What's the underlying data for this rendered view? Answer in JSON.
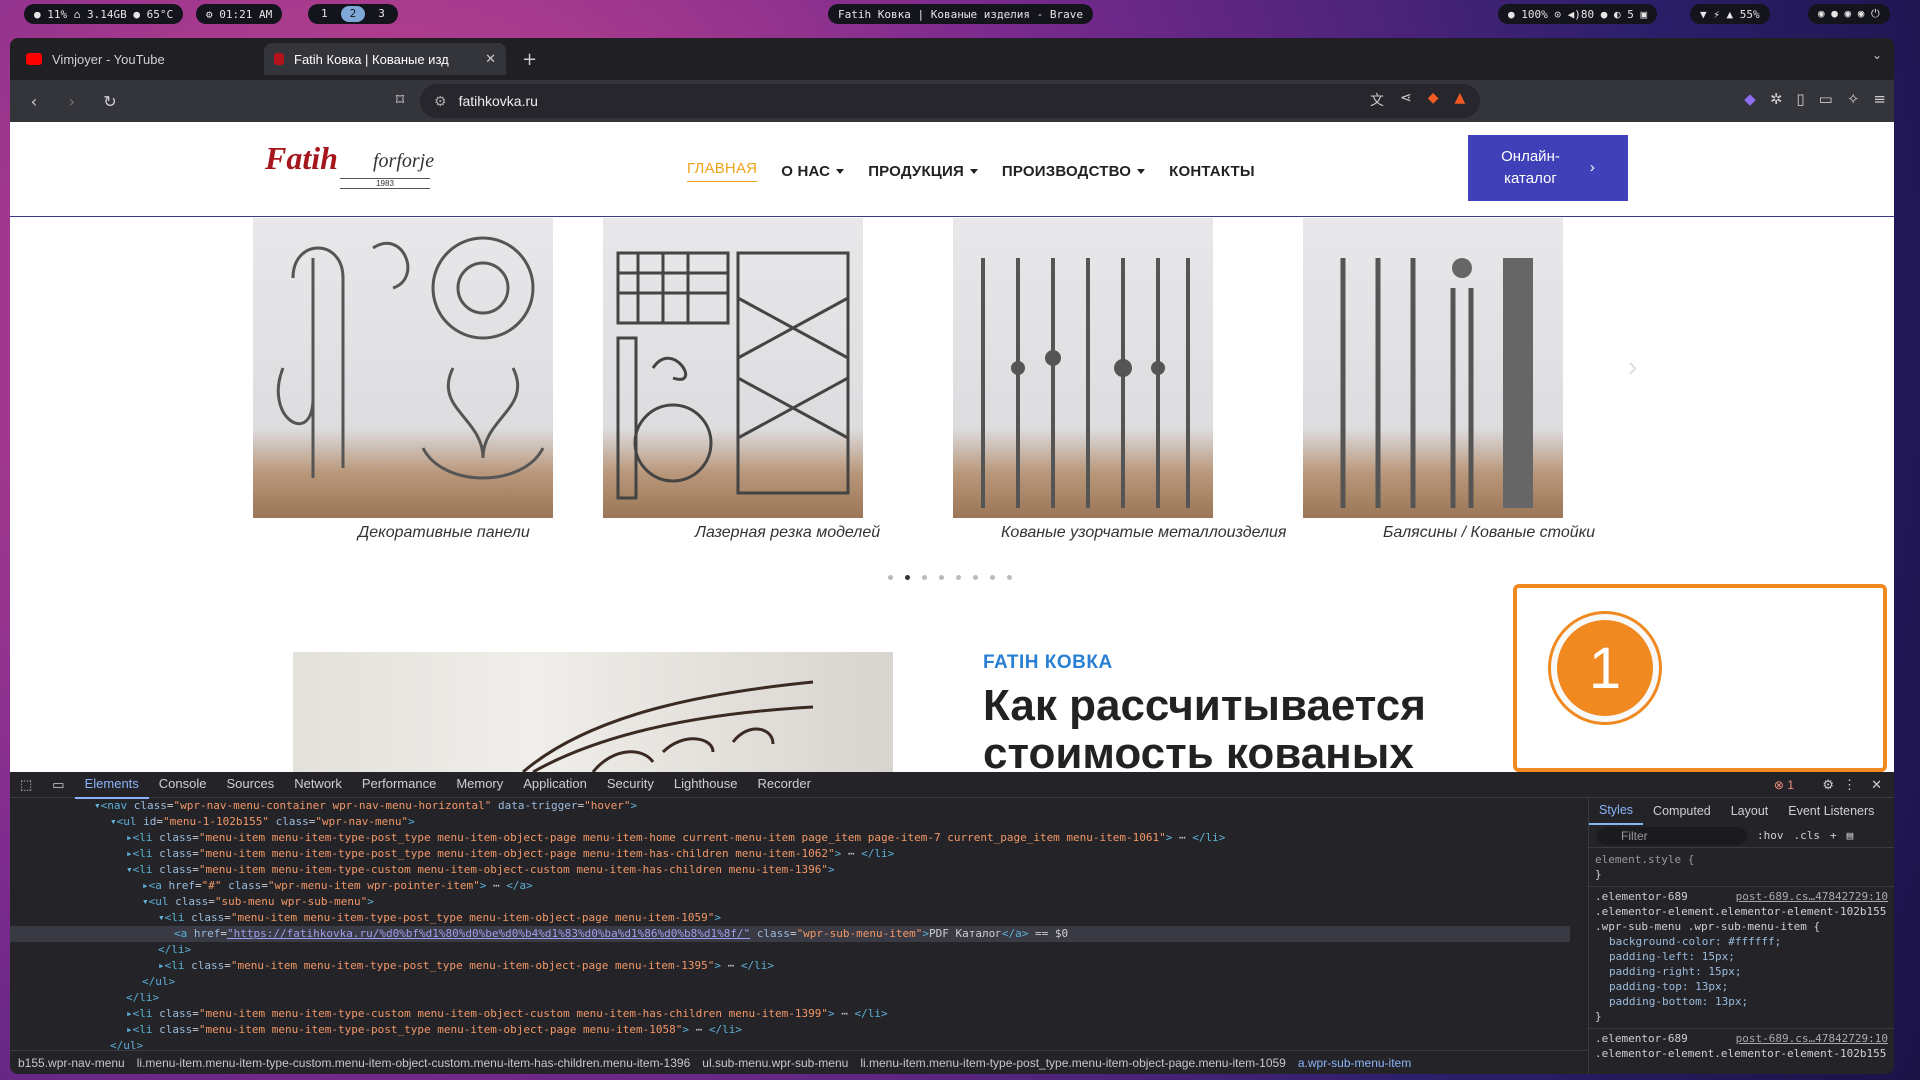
{
  "waybar": {
    "left": "● 11%  ⌂ 3.14GB  ● 65°C",
    "clock": "⚙ 01:21 AM",
    "workspaces": [
      "1",
      "2",
      "3"
    ],
    "active_workspace_index": 1,
    "title": "Fatih Ковка | Кованые изделия - Brave",
    "status": "● 100%  ⊙  ◀)80  ● ◐ 5  ▣",
    "net": "▼ ⚡ ▲ 55%",
    "tray": "◉ ● ◉ ◉ ⏻"
  },
  "browser": {
    "tabs": [
      {
        "title": "Vimjoyer - YouTube",
        "favicon_color": "#ff0000",
        "active": false
      },
      {
        "title": "Fatih Ковка | Кованые изд",
        "favicon_color": "#b3121b",
        "active": true
      }
    ],
    "new_tab": "+",
    "url": "fatihkovka.ru",
    "brave_badge": "1"
  },
  "site": {
    "logo": {
      "main": "Fatih",
      "script": "forforje",
      "year": "1983"
    },
    "nav": [
      {
        "label": "ГЛАВНАЯ",
        "active": true,
        "has_menu": false
      },
      {
        "label": "О НАС",
        "active": false,
        "has_menu": true
      },
      {
        "label": "ПРОДУКЦИЯ",
        "active": false,
        "has_menu": true
      },
      {
        "label": "ПРОИЗВОДСТВО",
        "active": false,
        "has_menu": true
      },
      {
        "label": "КОНТАКТЫ",
        "active": false,
        "has_menu": false
      }
    ],
    "catalog_button": "Онлайн-\nкаталог",
    "slides": [
      {
        "caption": "Декоративные панели"
      },
      {
        "caption": "Лазерная резка моделей"
      },
      {
        "caption": "Кованые узорчатые металлоизделия"
      },
      {
        "caption": "Балясины / Кованые стойки"
      }
    ],
    "dots_count": 8,
    "active_dot": 1,
    "brand": "FATIH КОВКА",
    "heading": "Как рассчитывается стоимость кованых",
    "notification_count": "1"
  },
  "devtools": {
    "tabs": [
      "Elements",
      "Console",
      "Sources",
      "Network",
      "Performance",
      "Memory",
      "Application",
      "Security",
      "Lighthouse",
      "Recorder"
    ],
    "active_tab": "Elements",
    "error_count": "1",
    "dom_lines": [
      {
        "indent": 10,
        "html": "<span class='tg'>▾&lt;nav</span> <span class='an'>class</span>=<span class='av'>\"wpr-nav-menu-container wpr-nav-menu-horizontal\"</span> <span class='an'>data-trigger</span>=<span class='av'>\"hover\"</span><span class='tg'>&gt;</span>"
      },
      {
        "indent": 12,
        "html": "<span class='tg'>▾&lt;ul</span> <span class='an'>id</span>=<span class='av'>\"menu-1-102b155\"</span> <span class='an'>class</span>=<span class='av'>\"wpr-nav-menu\"</span><span class='tg'>&gt;</span>"
      },
      {
        "indent": 14,
        "html": "<span class='tg'>▸&lt;li</span> <span class='an'>class</span>=<span class='av'>\"menu-item menu-item-type-post_type menu-item-object-page menu-item-home current-menu-item page_item page-item-7 current_page_item menu-item-1061\"</span><span class='tg'>&gt;</span> ⋯ <span class='tg'>&lt;/li&gt;</span>"
      },
      {
        "indent": 14,
        "html": "<span class='tg'>▸&lt;li</span> <span class='an'>class</span>=<span class='av'>\"menu-item menu-item-type-post_type menu-item-object-page menu-item-has-children menu-item-1062\"</span><span class='tg'>&gt;</span> ⋯ <span class='tg'>&lt;/li&gt;</span>"
      },
      {
        "indent": 14,
        "html": "<span class='tg'>▾&lt;li</span> <span class='an'>class</span>=<span class='av'>\"menu-item menu-item-type-custom menu-item-object-custom menu-item-has-children menu-item-1396\"</span><span class='tg'>&gt;</span>"
      },
      {
        "indent": 16,
        "html": "<span class='tg'>▸&lt;a</span> <span class='an'>href</span>=<span class='av'>\"#\"</span> <span class='an'>class</span>=<span class='av'>\"wpr-menu-item wpr-pointer-item\"</span><span class='tg'>&gt;</span> ⋯ <span class='tg'>&lt;/a&gt;</span>"
      },
      {
        "indent": 16,
        "html": "<span class='tg'>▾&lt;ul</span> <span class='an'>class</span>=<span class='av'>\"sub-menu wpr-sub-menu\"</span><span class='tg'>&gt;</span>"
      },
      {
        "indent": 18,
        "html": "<span class='tg'>▾&lt;li</span> <span class='an'>class</span>=<span class='av'>\"menu-item menu-item-type-post_type menu-item-object-page menu-item-1059\"</span><span class='tg'>&gt;</span>"
      },
      {
        "indent": 20,
        "sel": true,
        "html": "<span class='tg'>&lt;a</span> <span class='an'>href</span>=<span class='lk'>\"https://fatihkovka.ru/%d0%bf%d1%80%d0%be%d0%b4%d1%83%d0%ba%d1%86%d0%b8%d1%8f/\"</span> <span class='an'>class</span>=<span class='av'>\"wpr-sub-menu-item\"</span><span class='tg'>&gt;</span>PDF Каталог<span class='tg'>&lt;/a&gt;</span> == $0"
      },
      {
        "indent": 18,
        "html": "<span class='tg'>&lt;/li&gt;</span>"
      },
      {
        "indent": 18,
        "html": "<span class='tg'>▸&lt;li</span> <span class='an'>class</span>=<span class='av'>\"menu-item menu-item-type-post_type menu-item-object-page menu-item-1395\"</span><span class='tg'>&gt;</span> ⋯ <span class='tg'>&lt;/li&gt;</span>"
      },
      {
        "indent": 16,
        "html": "<span class='tg'>&lt;/ul&gt;</span>"
      },
      {
        "indent": 14,
        "html": "<span class='tg'>&lt;/li&gt;</span>"
      },
      {
        "indent": 14,
        "html": "<span class='tg'>▸&lt;li</span> <span class='an'>class</span>=<span class='av'>\"menu-item menu-item-type-custom menu-item-object-custom menu-item-has-children menu-item-1399\"</span><span class='tg'>&gt;</span> ⋯ <span class='tg'>&lt;/li&gt;</span>"
      },
      {
        "indent": 14,
        "html": "<span class='tg'>▸&lt;li</span> <span class='an'>class</span>=<span class='av'>\"menu-item menu-item-type-post_type menu-item-object-page menu-item-1058\"</span><span class='tg'>&gt;</span> ⋯ <span class='tg'>&lt;/li&gt;</span>"
      },
      {
        "indent": 12,
        "html": "<span class='tg'>&lt;/ul&gt;</span>"
      }
    ],
    "breadcrumbs": [
      "b155.wpr-nav-menu",
      "li.menu-item.menu-item-type-custom.menu-item-object-custom.menu-item-has-children.menu-item-1396",
      "ul.sub-menu.wpr-sub-menu",
      "li.menu-item.menu-item-type-post_type.menu-item-object-page.menu-item-1059",
      "a.wpr-sub-menu-item"
    ],
    "styles": {
      "tabs": [
        "Styles",
        "Computed",
        "Layout",
        "Event Listeners"
      ],
      "filter_placeholder": "Filter",
      "hov": ":hov",
      "cls": ".cls",
      "element_style": "element.style {",
      "close_brace": "}",
      "rule1_source": "post-689.cs…47842729:10",
      "rule1_selector_a": ".elementor-689",
      ".dummy": "",
      "rule1_selector_b": ".elementor-element.elementor-element-102b155",
      "rule1_selector_c": ".wpr-sub-menu .wpr-sub-menu-item {",
      "props": [
        "background-color: #ffffff;",
        "padding-left: 15px;",
        "padding-right: 15px;",
        "padding-top: 13px;",
        "padding-bottom: 13px;"
      ],
      "rule2_source": "post-689.cs…47842729:10",
      "rule2_selector_a": ".elementor-689",
      "rule2_selector_b": ".elementor-element.elementor-element-102b155"
    }
  },
  "colors": {
    "accent": "#f0a21d",
    "catalog": "#4040b8",
    "brand_blue": "#2a7fd4",
    "notification": "#f0891f",
    "whatsapp": "#25d366"
  }
}
